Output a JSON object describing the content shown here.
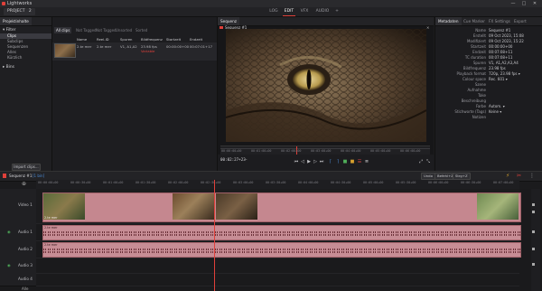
{
  "app": {
    "title": "Lightworks",
    "win_min": "—",
    "win_max": "□",
    "win_close": "✕"
  },
  "menubar": {
    "project_label": "PROJECT",
    "project_badge": "2",
    "tabs": [
      "LOG",
      "EDIT",
      "VFX",
      "AUDIO",
      "+"
    ],
    "active_tab": "EDIT"
  },
  "left_tabs": [
    "Projektinhalte",
    "Quelle",
    "Transitions",
    "Video FX",
    "Audio FX"
  ],
  "sidebar": {
    "filter_label": "Filter",
    "items": [
      "Clips",
      "Subclips",
      "Sequenzen",
      "Alles",
      "Kürzlich"
    ],
    "selected": "Clips",
    "bins_label": "Bins",
    "import_button": "Import clips..."
  },
  "pool": {
    "tabs": [
      "All clips",
      "Not Tagged",
      "Not Tagged",
      "Unsorted",
      "Sorted"
    ],
    "active_tab": "All clips",
    "columns": [
      "Name",
      "Reel-ID",
      "Spuren",
      "Bildfrequenz",
      "Startzeit",
      "Endzeit"
    ],
    "rows": [
      {
        "name": "2.te mer",
        "reel": "2.te mer",
        "tracks": "V1, A1,A2",
        "fps": "23.98 fps",
        "fps_note": "Variable",
        "start": "00:00:00+00",
        "end": "00:07:01+17"
      }
    ],
    "list_icon": "≡",
    "grid_icon": "▦",
    "search_icon": "⌕"
  },
  "viewer": {
    "tab": "Sequenz",
    "sequence_name": "Sequenz #1",
    "close": "✕",
    "timecode": "00:02:27+23",
    "timecode_suffix": "~",
    "ruler_ticks": [
      "00:00:00+00",
      "00:01:00+00",
      "00:02:00+00",
      "00:03:00+00",
      "00:04:00+00",
      "00:05:00+00",
      "00:06:00+00"
    ],
    "playhead_fraction": 0.35
  },
  "metadata": {
    "tabs": [
      "Metadaten",
      "Cue Marker",
      "FX Settings",
      "Export"
    ],
    "active_tab": "Metadaten",
    "fields": [
      {
        "k": "Name",
        "v": "Sequenz #1"
      },
      {
        "k": "Erstellt",
        "v": "09 Oct 2023, 15:08"
      },
      {
        "k": "Modifiziert",
        "v": "09 Oct 2023, 15:22"
      },
      {
        "k": "Startzeit",
        "v": "00:00:00+00"
      },
      {
        "k": "Endzeit",
        "v": "00:07:08+11"
      },
      {
        "k": "TC duration",
        "v": "00:07:08+11"
      },
      {
        "k": "Spuren",
        "v": "V1, A1,A2,A3,A4"
      },
      {
        "k": "Bildfrequenz",
        "v": "23.98 fps"
      },
      {
        "k": "Playback format",
        "v": "720p, 23.98 fps ▾"
      },
      {
        "k": "Colour space",
        "v": "Rec. 601 ▾"
      },
      {
        "k": "Szene",
        "v": ""
      },
      {
        "k": "Aufnahme",
        "v": ""
      },
      {
        "k": "Take",
        "v": ""
      },
      {
        "k": "Beschreibung",
        "v": ""
      },
      {
        "k": "Farbe",
        "v": "Autom. ▾"
      },
      {
        "k": "Stichworte (Tags)",
        "v": "Keine ▾"
      },
      {
        "k": "Notizen",
        "v": ""
      }
    ]
  },
  "timeline": {
    "sequence_label": "Sequenz #1",
    "clip_count": "[1 bin]",
    "undo": "Undo",
    "redo_shortcut": "Befehl+Z",
    "redo_shortcut2": "Strg+Z",
    "ruler": [
      "00:00:00+00",
      "00:00:30+00",
      "00:01:00+00",
      "00:01:30+00",
      "00:02:00+00",
      "00:02:30+00",
      "00:03:00+00",
      "00:03:30+00",
      "00:04:00+00",
      "00:04:30+00",
      "00:05:00+00",
      "00:05:30+00",
      "00:06:00+00",
      "00:06:30+00",
      "00:07:00+00"
    ],
    "tracks": [
      "Video 1",
      "Audio 1",
      "Audio 2",
      "Audio 3",
      "Audio 4"
    ],
    "clip_label": "2.te mer",
    "all_label": "Alle",
    "zoom_icon": "⊕"
  },
  "colors": {
    "accent": "#e0403a",
    "clip_pink": "#c5878f"
  }
}
